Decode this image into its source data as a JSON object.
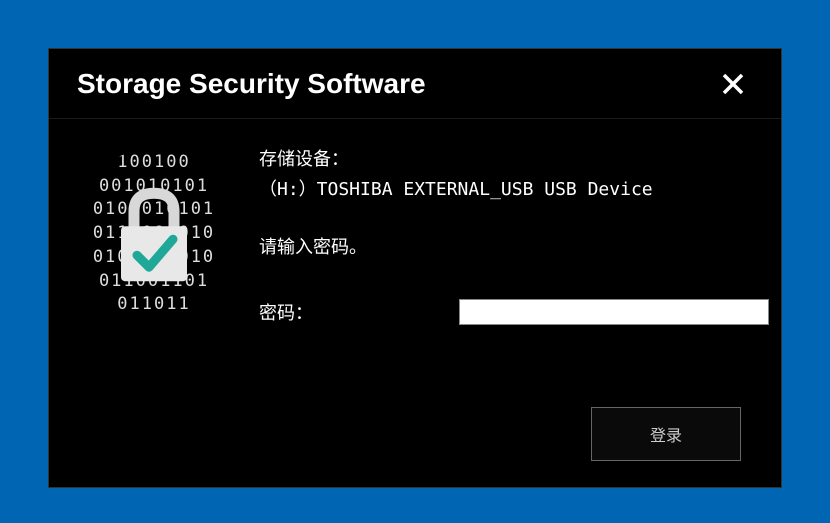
{
  "window": {
    "title": "Storage Security Software"
  },
  "content": {
    "device_label": "存储设备：",
    "device_name": "（H:）TOSHIBA EXTERNAL_USB USB Device",
    "prompt": "请输入密码。",
    "password_label": "密码：",
    "password_value": "",
    "login_label": "登录"
  }
}
